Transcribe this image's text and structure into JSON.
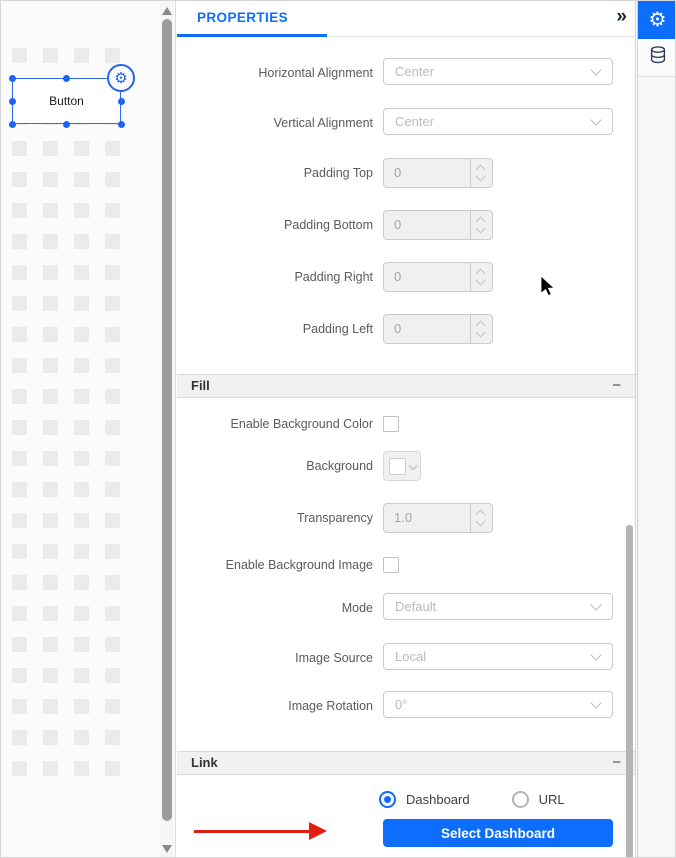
{
  "canvas": {
    "widget": {
      "label": "Button"
    }
  },
  "panel": {
    "title": "PROPERTIES",
    "collapse_icon": "»",
    "general": {
      "rows": [
        {
          "label": "Horizontal Alignment",
          "control": "select",
          "value": "Center"
        },
        {
          "label": "Vertical Alignment",
          "control": "select",
          "value": "Center"
        },
        {
          "label": "Padding Top",
          "control": "spinner",
          "value": "0"
        },
        {
          "label": "Padding Bottom",
          "control": "spinner",
          "value": "0"
        },
        {
          "label": "Padding Right",
          "control": "spinner",
          "value": "0"
        },
        {
          "label": "Padding Left",
          "control": "spinner",
          "value": "0"
        }
      ]
    },
    "fill": {
      "title": "Fill",
      "collapse_icon": "−",
      "rows": [
        {
          "label": "Enable Background Color",
          "control": "checkbox",
          "checked": false
        },
        {
          "label": "Background",
          "control": "colorpicker"
        },
        {
          "label": "Transparency",
          "control": "spinner",
          "value": "1.0"
        },
        {
          "label": "Enable Background Image",
          "control": "checkbox",
          "checked": false
        },
        {
          "label": "Mode",
          "control": "select",
          "value": "Default"
        },
        {
          "label": "Image Source",
          "control": "select",
          "value": "Local"
        },
        {
          "label": "Image Rotation",
          "control": "select",
          "value": "0°"
        }
      ]
    },
    "link": {
      "title": "Link",
      "collapse_icon": "−",
      "radio_options": [
        {
          "label": "Dashboard",
          "selected": true
        },
        {
          "label": "URL",
          "selected": false
        }
      ],
      "button_label": "Select Dashboard"
    }
  },
  "toolbar": {
    "items": [
      {
        "name": "properties",
        "icon": "gear-icon",
        "active": true
      },
      {
        "name": "data",
        "icon": "database-icon",
        "active": false
      }
    ],
    "gear_glyph": "⚙"
  },
  "widget_gear_glyph": "⚙",
  "colors": {
    "accent": "#0d6efd",
    "selection": "#1c64f2",
    "annotation_arrow": "#e21d12",
    "grid_square": "#ebebeb"
  }
}
